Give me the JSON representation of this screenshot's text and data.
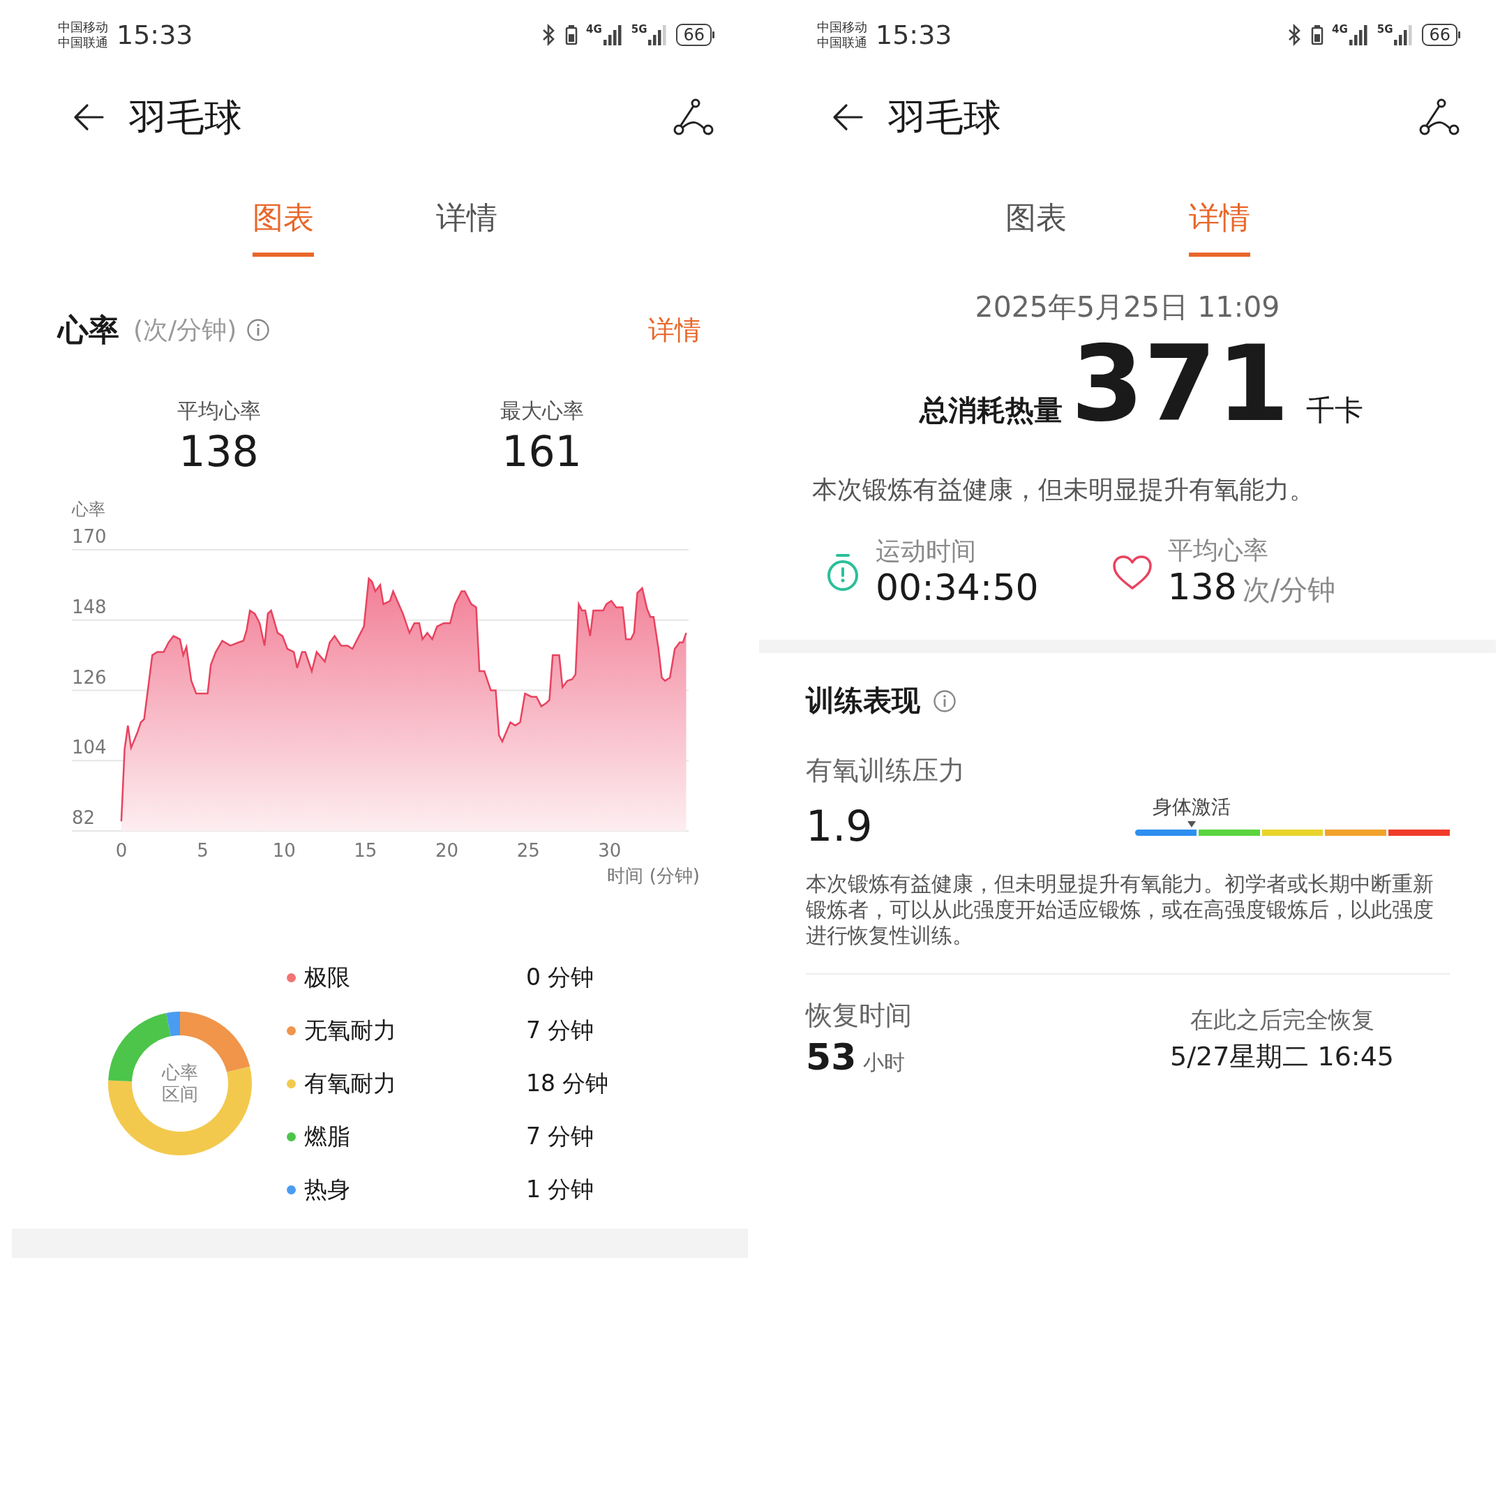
{
  "chart_screen": {
    "status_bar": {
      "carriers": [
        "中国移动",
        "中国联通"
      ],
      "time": "15:33",
      "networks": [
        "4G",
        "5G"
      ],
      "battery": "66"
    },
    "header": {
      "title": "羽毛球"
    },
    "tabs": [
      {
        "label": "图表",
        "selected": true
      },
      {
        "label": "详情",
        "selected": false
      }
    ],
    "heart_rate": {
      "title": "心率",
      "unit": "(次/分钟)",
      "link": "详情",
      "stats": [
        {
          "label": "平均心率",
          "value": "138"
        },
        {
          "label": "最大心率",
          "value": "161"
        }
      ],
      "chart_data": {
        "type": "area",
        "grid": true,
        "xlabel": "时间 (分钟)",
        "ylabel": "心率",
        "xlim": [
          -3.04,
          34.85
        ],
        "ylim": [
          82,
          170
        ],
        "xticks": [
          0,
          5,
          10,
          15,
          20,
          25,
          30
        ],
        "yticks": [
          82,
          104,
          126,
          148,
          170
        ],
        "x": [
          0,
          0.2,
          0.4,
          0.6,
          1.0,
          1.2,
          1.4,
          1.7,
          1.9,
          2.2,
          2.6,
          2.9,
          3.2,
          3.6,
          3.8,
          4.0,
          4.3,
          4.6,
          5.3,
          5.5,
          5.8,
          6.2,
          6.7,
          7.2,
          7.5,
          7.7,
          7.9,
          8.2,
          8.5,
          8.8,
          9.0,
          9.2,
          9.6,
          9.9,
          10.2,
          10.6,
          10.8,
          11.1,
          11.3,
          11.7,
          12.0,
          12.5,
          12.8,
          13.1,
          13.5,
          13.9,
          14.2,
          14.6,
          14.9,
          15.2,
          15.4,
          15.6,
          15.9,
          16.1,
          16.5,
          16.7,
          17.3,
          17.7,
          18.0,
          18.3,
          18.5,
          18.8,
          19.1,
          19.4,
          19.8,
          20.2,
          20.5,
          20.9,
          21.1,
          21.5,
          21.8,
          22.0,
          22.3,
          22.7,
          23.0,
          23.2,
          23.4,
          23.9,
          24.2,
          24.5,
          24.8,
          25.2,
          25.5,
          25.8,
          26.1,
          26.3,
          26.5,
          26.9,
          27.1,
          27.4,
          27.7,
          27.9,
          28.1,
          28.3,
          28.5,
          28.8,
          29.0,
          29.6,
          29.8,
          30.1,
          30.4,
          30.8,
          31.0,
          31.3,
          31.5,
          31.7,
          32.0,
          32.3,
          32.5,
          32.7,
          33.0,
          33.2,
          33.4,
          33.7,
          34.0,
          34.3,
          34.5,
          34.7
        ],
        "values": [
          85,
          107.6,
          115,
          108,
          113,
          116,
          117,
          129,
          137,
          138,
          138,
          141,
          143,
          142,
          137,
          139.6,
          129,
          125,
          125,
          134,
          138,
          141.5,
          140,
          141,
          141.5,
          145,
          151,
          150,
          147,
          140,
          150,
          151,
          144,
          143,
          139,
          138,
          133,
          138,
          138,
          132,
          138,
          135,
          141,
          143,
          140,
          140,
          139,
          143,
          146,
          161,
          160,
          157,
          159,
          153,
          154,
          157,
          150,
          144,
          147,
          147,
          142,
          144,
          142,
          146,
          147,
          147,
          153,
          157,
          157,
          153,
          152,
          132,
          132,
          126,
          126,
          112,
          110,
          116,
          115,
          116,
          125,
          124,
          124,
          121,
          122,
          123,
          137,
          137,
          127,
          129,
          129.5,
          131,
          153,
          151,
          151,
          143,
          151,
          151,
          153,
          154,
          152,
          152,
          142,
          142,
          144,
          156.5,
          158,
          151.5,
          149,
          149,
          139,
          130,
          129,
          130,
          139,
          141,
          141,
          144
        ]
      }
    },
    "zones": {
      "center_label": [
        "心率",
        "区间"
      ],
      "chart_data": {
        "type": "donut",
        "categories": [
          "极限",
          "无氧耐力",
          "有氧耐力",
          "燃脂",
          "热身"
        ],
        "values": [
          0,
          21.2,
          54.5,
          21.2,
          3.1
        ]
      },
      "legend": [
        {
          "value": "0 分钟",
          "color": "#f07474"
        },
        {
          "value": "7 分钟",
          "color": "#f0954a"
        },
        {
          "value": "18 分钟",
          "color": "#f2c94c"
        },
        {
          "value": "7 分钟",
          "color": "#4cc54a"
        },
        {
          "value": "1 分钟",
          "color": "#4a9cf0"
        }
      ]
    }
  },
  "detail_screen": {
    "status_bar": {
      "carriers": [
        "中国移动",
        "中国联通"
      ],
      "time": "15:33",
      "networks": [
        "4G",
        "5G"
      ],
      "battery": "66"
    },
    "header": {
      "title": "羽毛球"
    },
    "tabs": [
      {
        "label": "图表",
        "selected": false
      },
      {
        "label": "详情",
        "selected": true
      }
    ],
    "date": "2025年5月25日 11:09",
    "calories": {
      "label": "总消耗热量",
      "value": "371",
      "unit": "千卡"
    },
    "summary": "本次锻炼有益健康，但未明显提升有氧能力。",
    "metrics": [
      {
        "kind": "duration",
        "label": "运动时间",
        "value": "00:34:50"
      },
      {
        "kind": "heart",
        "label": "平均心率",
        "value": "138",
        "unit": "次/分钟"
      }
    ],
    "training": {
      "title": "训练表现",
      "load_label": "有氧训练压力",
      "load_value": "1.9",
      "scale": {
        "label": "身体激活",
        "segments": [
          {
            "color": "#2e8ff0"
          },
          {
            "color": "#5bd43f"
          },
          {
            "color": "#e8d42a"
          },
          {
            "color": "#f2a22c"
          },
          {
            "color": "#f03b2a"
          }
        ]
      },
      "description": "本次锻炼有益健康，但未明显提升有氧能力。初学者或长期中断重新锻炼者，可以从此强度开始适应锻炼，或在高强度锻炼后，以此强度进行恢复性训练。"
    },
    "recovery": {
      "label": "恢复时间",
      "value": "53",
      "unit": "小时",
      "until_label": "在此之后完全恢复",
      "until": "5/27星期二 16:45"
    }
  }
}
